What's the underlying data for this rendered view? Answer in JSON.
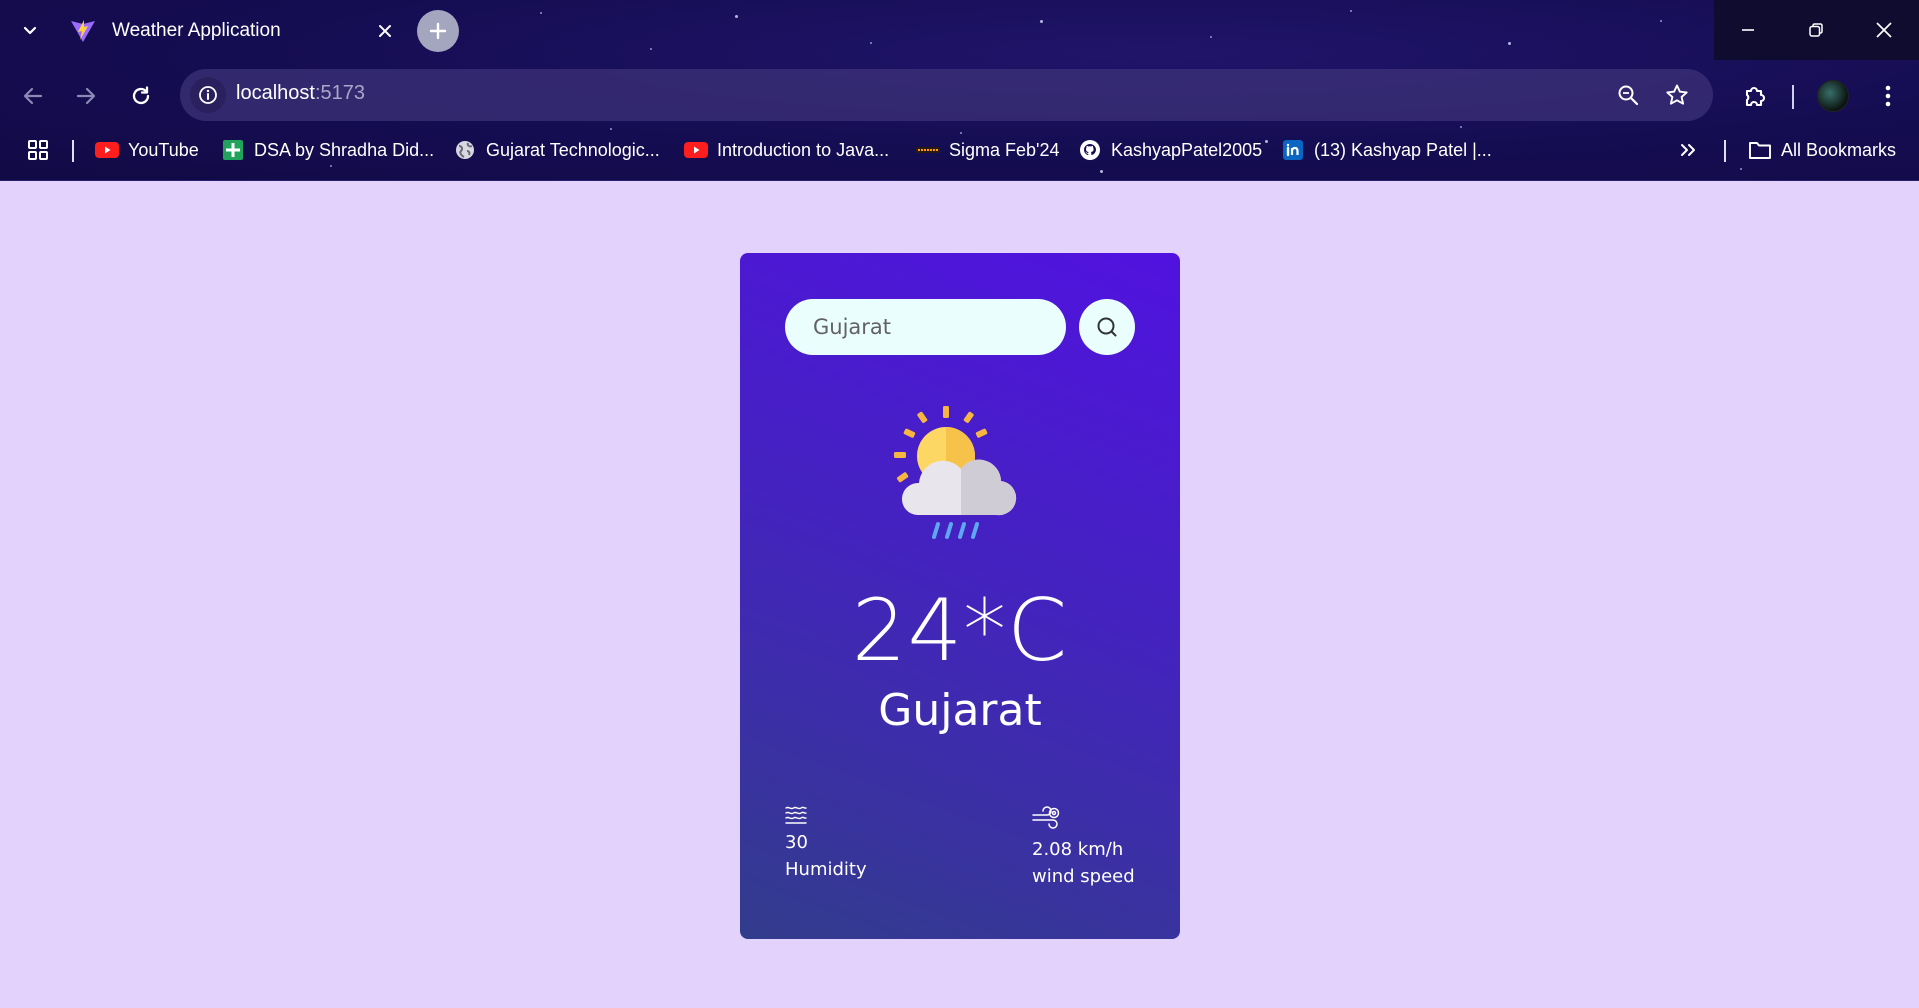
{
  "browser": {
    "tab": {
      "title": "Weather Application"
    },
    "address": {
      "host": "localhost",
      "port": ":5173"
    },
    "bookmarks": [
      {
        "label": "YouTube",
        "icon": "youtube-icon"
      },
      {
        "label": "DSA by Shradha Did...",
        "icon": "sheets-icon"
      },
      {
        "label": "Gujarat Technologic...",
        "icon": "globe-icon"
      },
      {
        "label": "Introduction to Java...",
        "icon": "youtube-icon"
      },
      {
        "label": "Sigma Feb'24",
        "icon": "college-icon"
      },
      {
        "label": "KashyapPatel2005",
        "icon": "github-icon"
      },
      {
        "label": "(13) Kashyap Patel |...",
        "icon": "linkedin-icon"
      }
    ],
    "all_bookmarks_label": "All Bookmarks"
  },
  "weather": {
    "search": {
      "value": "Gujarat",
      "placeholder": "Search"
    },
    "temperature": "24*C",
    "city": "Gujarat",
    "humidity": {
      "value": "30",
      "label": "Humidity"
    },
    "wind": {
      "value": "2.08 km/h",
      "label": "wind speed"
    },
    "icon": "partly-cloudy-rain-icon"
  },
  "colors": {
    "page_background": "#e3d3fc",
    "card_gradient_top": "#5112e0",
    "card_gradient_bottom": "#323c8c",
    "input_background": "#ebfefe"
  }
}
